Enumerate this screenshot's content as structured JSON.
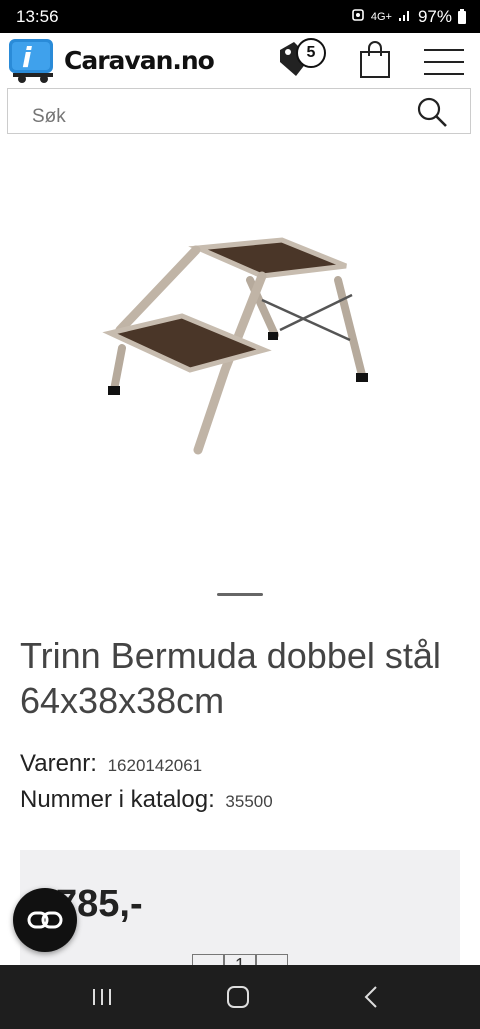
{
  "status": {
    "time": "13:56",
    "network": "4G+",
    "battery": "97%"
  },
  "header": {
    "logo_text": "Caravan.no",
    "tags_count": "5"
  },
  "search": {
    "placeholder": "Søk"
  },
  "product": {
    "title": "Trinn Bermuda dobbel stål 64x38x38cm",
    "varenr_label": "Varenr:",
    "varenr_value": "1620142061",
    "katalog_label": "Nummer i katalog:",
    "katalog_value": "35500",
    "price": "785,-",
    "quantity": "1"
  },
  "colors": {
    "logo_blue": "#2a8bd8",
    "price_box_bg": "#f0f0f2",
    "step_tread": "#4a3628",
    "frame": "#bfb3a6"
  }
}
